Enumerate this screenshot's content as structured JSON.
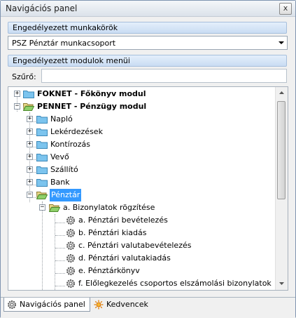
{
  "window": {
    "title": "Navigációs panel",
    "close_label": "x"
  },
  "roles_section": {
    "header": "Engedélyezett munkakörök",
    "selected_role": "PSZ Pénztár munkacsoport"
  },
  "modules_section": {
    "header": "Engedélyezett modulok menüi",
    "filter_label": "Szűrő:",
    "filter_value": ""
  },
  "tree": {
    "foknet": "FOKNET - Főkönyv modul",
    "pennet": "PENNET - Pénzügy modul",
    "naplo": "Napló",
    "lekerdezesek": "Lekérdezések",
    "kontirozas": "Kontírozás",
    "vevo": "Vevő",
    "szallito": "Szállító",
    "bank": "Bank",
    "penztar": "Pénztár",
    "bizonylatok": "a. Bizonylatok rögzítése",
    "items": [
      "a. Pénztári bevételezés",
      "b. Pénztári kiadás",
      "c. Pénztári valutabevételezés",
      "d. Pénztári valutakiadás",
      "e. Pénztárkönyv",
      "f. Előlegkezelés csoportos elszámolási bizonylatok"
    ]
  },
  "tabs": {
    "nav": "Navigációs panel",
    "favorites": "Kedvencek"
  },
  "colors": {
    "selection": "#3399ff",
    "header": "#c9dcf3",
    "folder": "#5eb4e8"
  }
}
